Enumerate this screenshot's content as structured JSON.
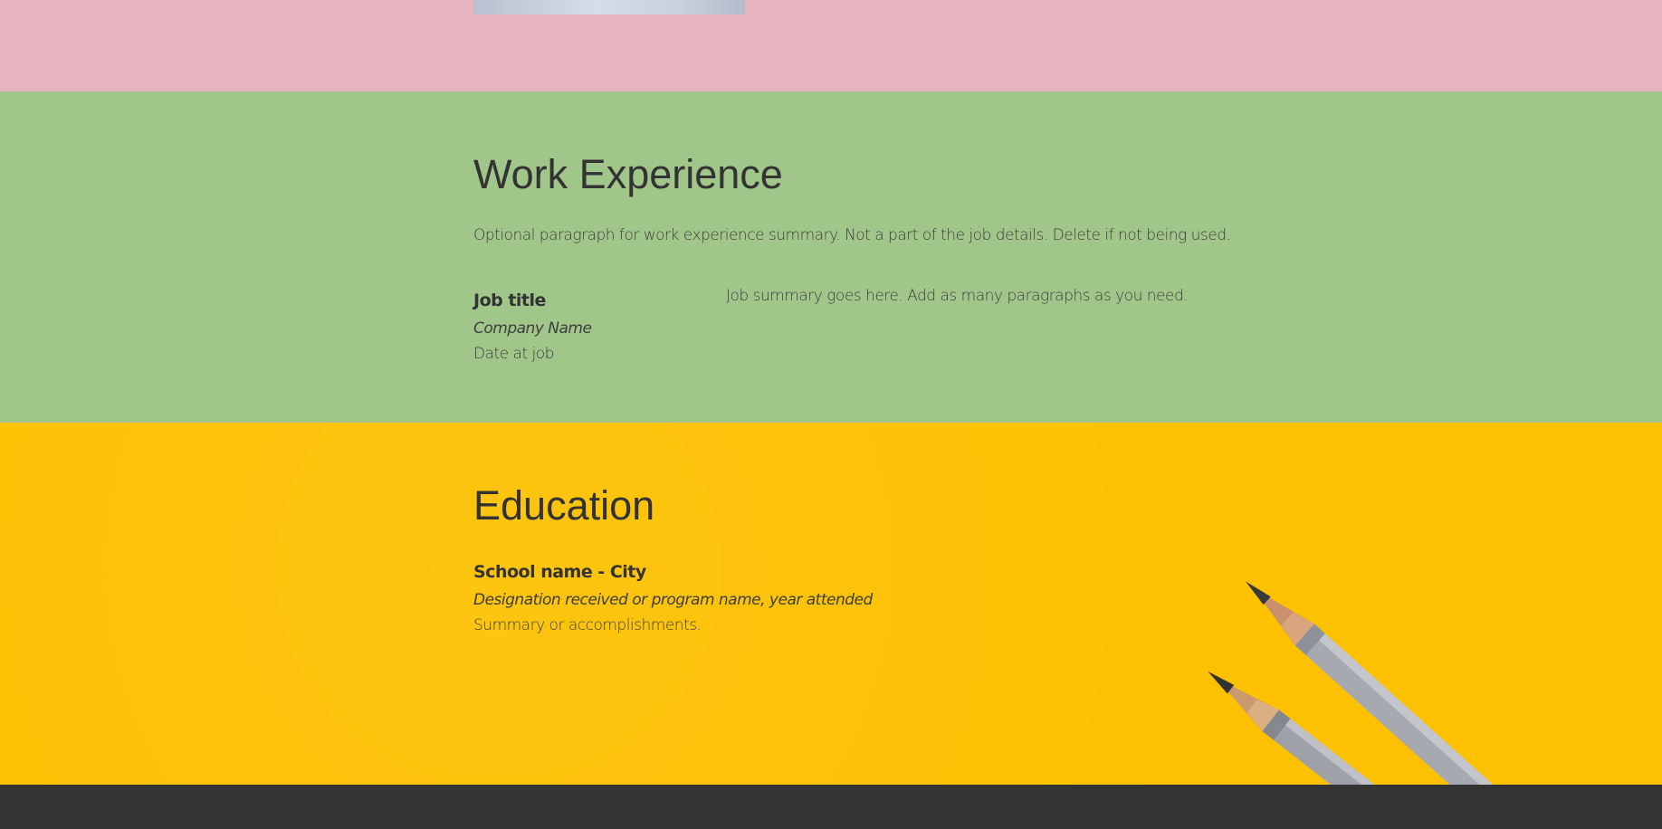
{
  "work": {
    "title": "Work Experience",
    "summary": "Optional paragraph for work experience summary. Not a part of the job details. Delete if not being used.",
    "job": {
      "title": "Job title",
      "company": "Company Name",
      "date": "Date at job",
      "description": "Job summary goes here. Add as many paragraphs as you need."
    }
  },
  "education": {
    "title": "Education",
    "school": "School name - City",
    "designation": "Designation received or program name, year attended",
    "summary": "Summary or accomplishments."
  },
  "colors": {
    "pink_band": "#e5b4bf",
    "green_band": "#a1c68a",
    "yellow_band": "#fdc102",
    "footer": "#333333",
    "text": "#333333"
  },
  "icons": {
    "decor": "pencils-image"
  }
}
